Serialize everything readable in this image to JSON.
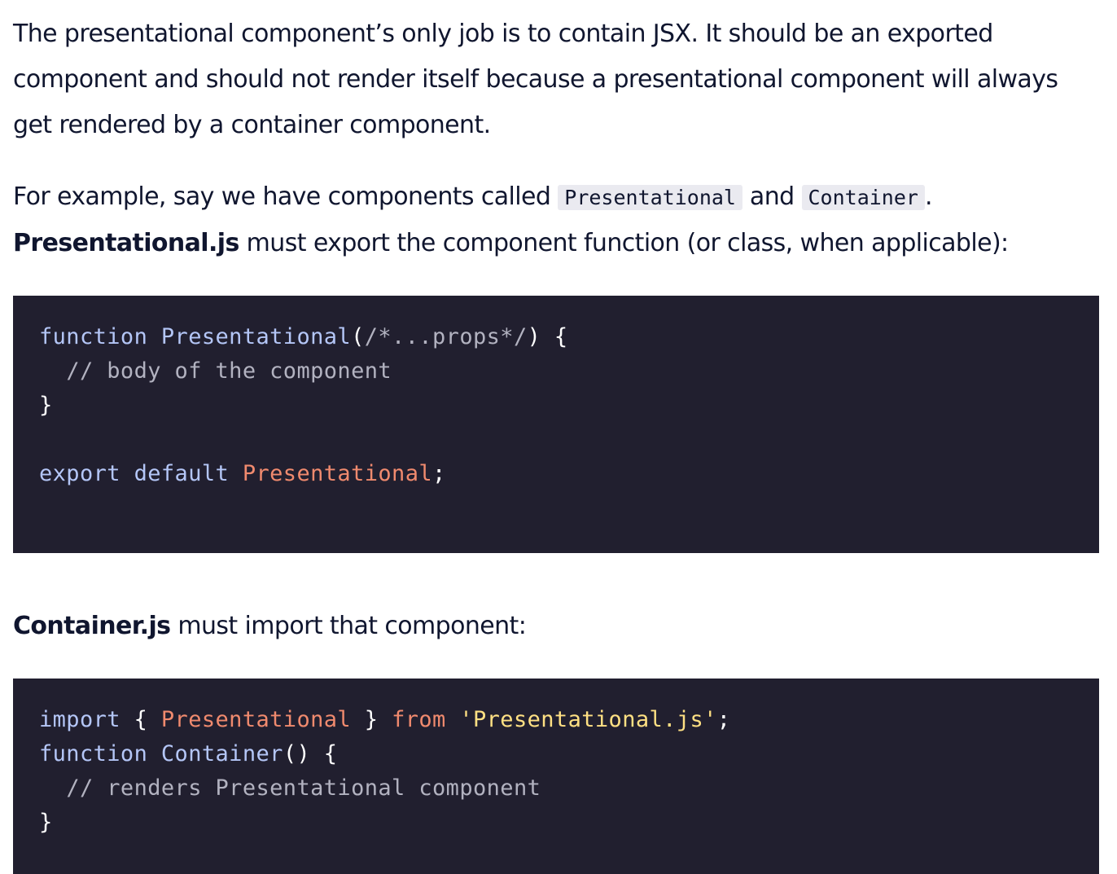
{
  "paragraph1": {
    "text": "The presentational component’s only job is to contain JSX. It should be an exported component and should not render itself because a presentational component will always get rendered by a container component."
  },
  "paragraph2": {
    "intro": "For example, say we have components called ",
    "code1": "Presentational",
    "and": " and ",
    "code2": "Container",
    "period": ".",
    "bold": "Presentational.js",
    "rest": " must export the component function (or class, when applicable):"
  },
  "code_block_1": {
    "l1_kw": "function",
    "l1_fn": "Presentational",
    "l1_p1": "(",
    "l1_cm": "/*...props*/",
    "l1_p2": ") {",
    "l2_cm": "// body of the component",
    "l3_p": "}",
    "l5_kw1": "export",
    "l5_kw2": "default",
    "l5_id": "Presentational",
    "l5_p": ";"
  },
  "paragraph3": {
    "bold": "Container.js",
    "rest": " must import that component:"
  },
  "code_block_2": {
    "l1_kw": "import",
    "l1_p1": "{",
    "l1_id": "Presentational",
    "l1_p2": "}",
    "l1_from": "from",
    "l1_str": "'Presentational.js'",
    "l1_p3": ";",
    "l2_kw": "function",
    "l2_fn": "Container",
    "l2_p": "() {",
    "l3_cm": "// renders Presentational component",
    "l4_p": "}"
  }
}
